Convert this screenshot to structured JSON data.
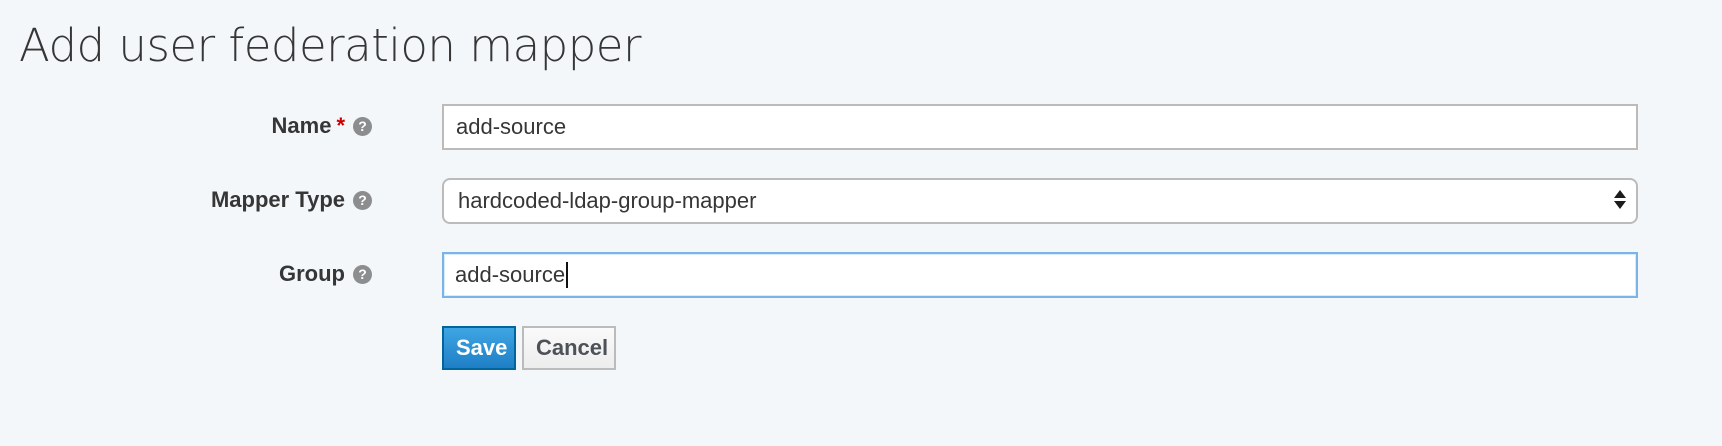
{
  "header": {
    "title": "Add user federation mapper"
  },
  "form": {
    "name": {
      "label": "Name",
      "required_marker": "*",
      "help": "?",
      "value": "add-source"
    },
    "mapper_type": {
      "label": "Mapper Type",
      "help": "?",
      "selected": "hardcoded-ldap-group-mapper"
    },
    "group": {
      "label": "Group",
      "help": "?",
      "value": "add-source"
    }
  },
  "actions": {
    "save_label": "Save",
    "cancel_label": "Cancel"
  },
  "colors": {
    "background": "#f4f7fa",
    "primary": "#1f7fc6",
    "required": "#cc0000",
    "focus_border": "#7ab3e8"
  },
  "icons": {
    "help": "question-circle-icon",
    "select": "sort-arrows-icon"
  }
}
